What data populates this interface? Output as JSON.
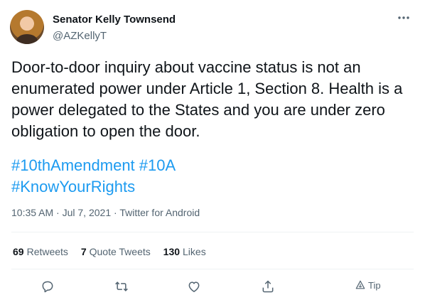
{
  "tweet": {
    "author": {
      "display_name": "Senator Kelly Townsend",
      "handle": "@AZKellyT"
    },
    "body": "Door-to-door inquiry about vaccine status is not an enumerated power under Article 1, Section 8.  Health is a power delegated to the States and you are under zero obligation to open the door.",
    "hashtags": {
      "tag1": "#10thAmendment",
      "tag2": "#10A",
      "tag3": "#KnowYourRights"
    },
    "meta": {
      "time": "10:35 AM",
      "separator1": " · ",
      "date": "Jul 7, 2021",
      "separator2": " · ",
      "source": "Twitter for Android"
    },
    "stats": {
      "retweets_count": "69",
      "retweets_label": "Retweets",
      "quotes_count": "7",
      "quotes_label": "Quote Tweets",
      "likes_count": "130",
      "likes_label": "Likes"
    },
    "actions": {
      "tip_label": "Tip",
      "icons": [
        "reply-icon",
        "retweet-icon",
        "like-icon",
        "share-icon",
        "tip-icon",
        "more-icon"
      ]
    }
  },
  "colors": {
    "text": "#0f1419",
    "secondary": "#536471",
    "link": "#1d9bf0",
    "divider": "#eff3f4"
  }
}
